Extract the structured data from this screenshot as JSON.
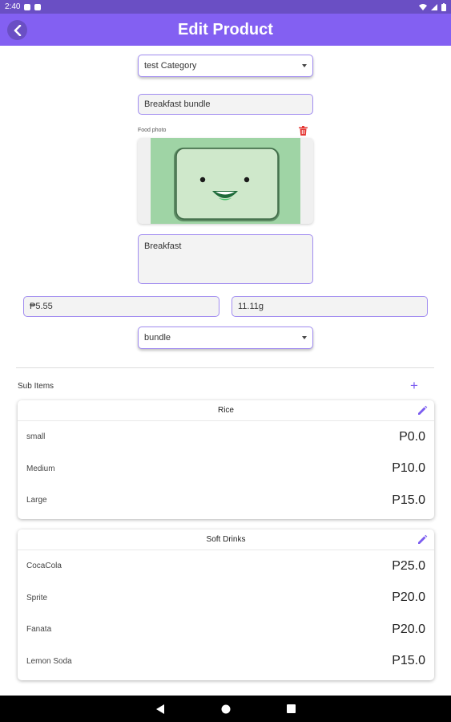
{
  "status_bar": {
    "time": "2:40"
  },
  "app_bar": {
    "title": "Edit Product"
  },
  "form": {
    "category": "test Category",
    "name": "Breakfast bundle",
    "photo_label": "Food photo",
    "description": "Breakfast",
    "price": "₱5.55",
    "weight": "11.11g",
    "type": "bundle"
  },
  "sub_items": {
    "label": "Sub Items",
    "groups": [
      {
        "title": "Rice",
        "items": [
          {
            "name": "small",
            "price": "P0.0"
          },
          {
            "name": "Medium",
            "price": "P10.0"
          },
          {
            "name": "Large",
            "price": "P15.0"
          }
        ]
      },
      {
        "title": "Soft Drinks",
        "items": [
          {
            "name": "CocaCola",
            "price": "P25.0"
          },
          {
            "name": "Sprite",
            "price": "P20.0"
          },
          {
            "name": "Fanata",
            "price": "P20.0"
          },
          {
            "name": "Lemon Soda",
            "price": "P15.0"
          }
        ]
      }
    ]
  },
  "colors": {
    "primary": "#8360f2",
    "status_bar": "#6a4fc4",
    "delete": "#e53935"
  },
  "icons": [
    "back-arrow-icon",
    "trash-icon",
    "plus-icon",
    "pencil-icon",
    "nav-back-icon",
    "nav-home-icon",
    "nav-recents-icon"
  ]
}
